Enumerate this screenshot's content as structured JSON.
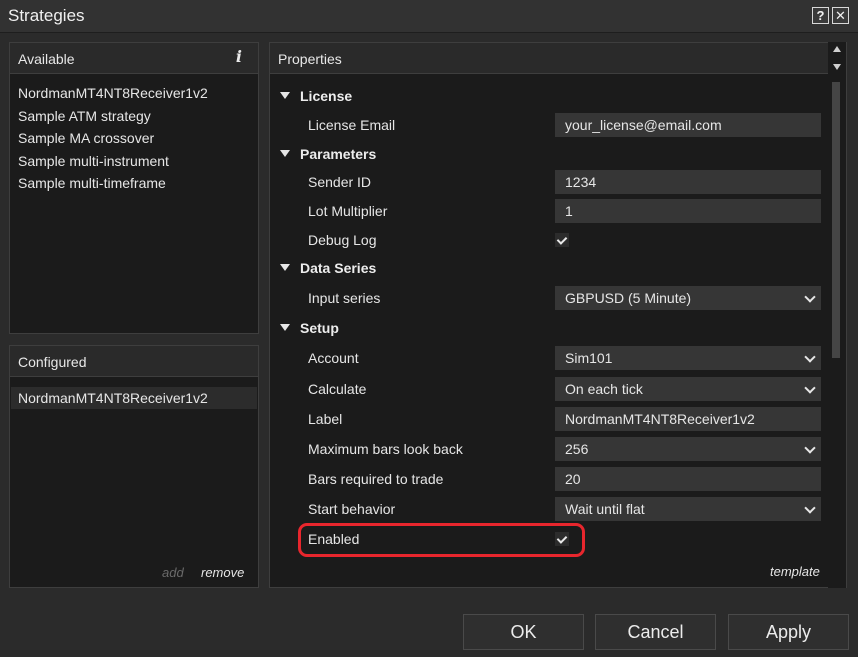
{
  "window": {
    "title": "Strategies",
    "help_label": "?",
    "close_label": "✕"
  },
  "available": {
    "header": "Available",
    "info_icon_label": "i",
    "items": [
      "NordmanMT4NT8Receiver1v2",
      "Sample ATM strategy",
      "Sample MA crossover",
      "Sample multi-instrument",
      "Sample multi-timeframe"
    ]
  },
  "configured": {
    "header": "Configured",
    "items": [
      "NordmanMT4NT8Receiver1v2"
    ],
    "add_label": "add",
    "remove_label": "remove"
  },
  "properties": {
    "header": "Properties",
    "template_label": "template",
    "categories": {
      "license": "License",
      "parameters": "Parameters",
      "data_series": "Data Series",
      "setup": "Setup"
    },
    "license_email": {
      "label": "License Email",
      "value": "your_license@email.com"
    },
    "sender_id": {
      "label": "Sender ID",
      "value": "1234"
    },
    "lot_multiplier": {
      "label": "Lot Multiplier",
      "value": "1"
    },
    "debug_log": {
      "label": "Debug Log",
      "checked": true
    },
    "input_series": {
      "label": "Input series",
      "value": "GBPUSD (5 Minute)"
    },
    "account": {
      "label": "Account",
      "value": "Sim101"
    },
    "calculate": {
      "label": "Calculate",
      "value": "On each tick"
    },
    "strategy_label": {
      "label": "Label",
      "value": "NordmanMT4NT8Receiver1v2"
    },
    "max_bars": {
      "label": "Maximum bars look back",
      "value": "256"
    },
    "bars_required": {
      "label": "Bars required to trade",
      "value": "20"
    },
    "start_behavior": {
      "label": "Start behavior",
      "value": "Wait until flat"
    },
    "enabled": {
      "label": "Enabled",
      "checked": true
    }
  },
  "buttons": {
    "ok": "OK",
    "cancel": "Cancel",
    "apply": "Apply"
  },
  "colors": {
    "background": "#2b2b2b",
    "panel": "#1b1b1b",
    "highlight": "#e8262d"
  }
}
